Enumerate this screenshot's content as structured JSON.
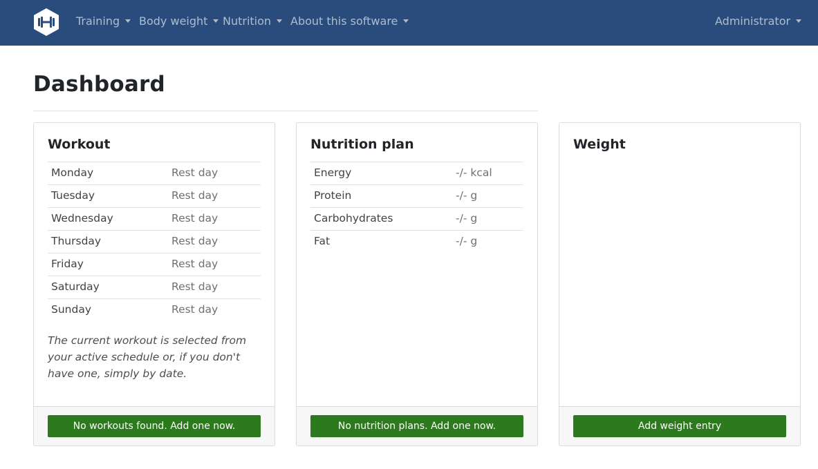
{
  "nav": {
    "logo": "dumbbell-logo",
    "items": [
      "Training",
      "Body weight",
      "Nutrition",
      "About this software"
    ],
    "user": "Administrator"
  },
  "page": {
    "title": "Dashboard"
  },
  "workout": {
    "title": "Workout",
    "rows": [
      {
        "day": "Monday",
        "status": "Rest day"
      },
      {
        "day": "Tuesday",
        "status": "Rest day"
      },
      {
        "day": "Wednesday",
        "status": "Rest day"
      },
      {
        "day": "Thursday",
        "status": "Rest day"
      },
      {
        "day": "Friday",
        "status": "Rest day"
      },
      {
        "day": "Saturday",
        "status": "Rest day"
      },
      {
        "day": "Sunday",
        "status": "Rest day"
      }
    ],
    "note": "The current workout is selected from your active schedule or, if you don't have one, simply by date.",
    "button": "No workouts found. Add one now."
  },
  "nutrition": {
    "title": "Nutrition plan",
    "rows": [
      {
        "name": "Energy",
        "value": "-/- kcal"
      },
      {
        "name": "Protein",
        "value": "-/- g"
      },
      {
        "name": "Carbohydrates",
        "value": "-/- g"
      },
      {
        "name": "Fat",
        "value": "-/- g"
      }
    ],
    "button": "No nutrition plans. Add one now."
  },
  "weight": {
    "title": "Weight",
    "button": "Add weight entry"
  },
  "colors": {
    "navbar": "#2a4c7d",
    "button": "#2d7a1e"
  }
}
